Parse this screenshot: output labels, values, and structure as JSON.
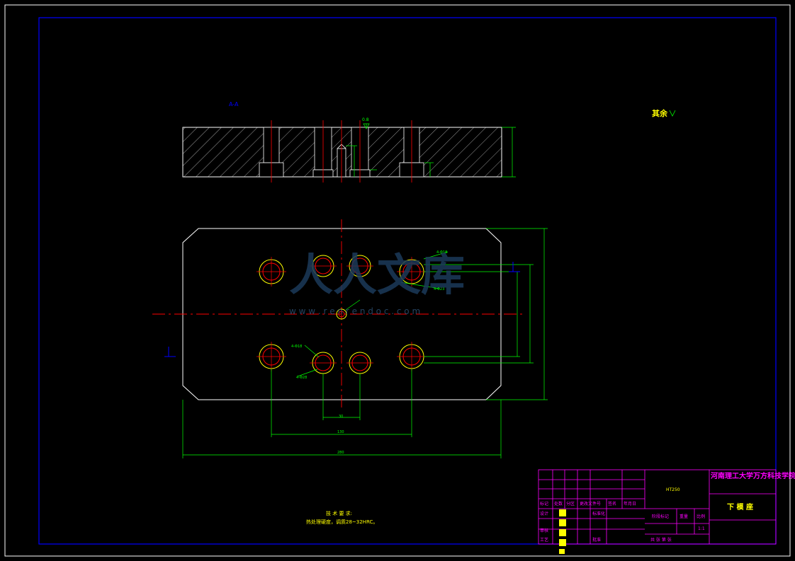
{
  "section_label": "A-A",
  "surface_finish_note": "其余",
  "top_roughness": "0.8",
  "watermark": {
    "logo_text": "人人文库",
    "url": "w w w . r e n r e n d o c . c o m"
  },
  "tech_requirements": {
    "title": "技 术 要 求:",
    "line1": "热处理硬度，调质28~32HRC。"
  },
  "title_block": {
    "school": "河南理工大学万方科技学院",
    "part_name": "下 模 座",
    "material": "HT250",
    "scale": "1:1",
    "row_labels": [
      "标记",
      "处数",
      "分区",
      "更改文件号",
      "签名",
      "年月日"
    ],
    "left_labels": [
      "设计",
      "审核",
      "工艺"
    ],
    "std_label": "标准化",
    "approve_label": "批准",
    "stage_mark": "阶段标记",
    "weight": "重量",
    "ratio": "比例",
    "sheets": "共  张 第  张"
  },
  "colors": {
    "outline": "#ffffff",
    "dimension": "#00ff00",
    "centerline": "#ff0000",
    "hatch": "#ffffff",
    "frame": "#0000ff",
    "title_frame": "#ff00ff",
    "text_yellow": "#ffff00",
    "holes": "#ffff00"
  }
}
